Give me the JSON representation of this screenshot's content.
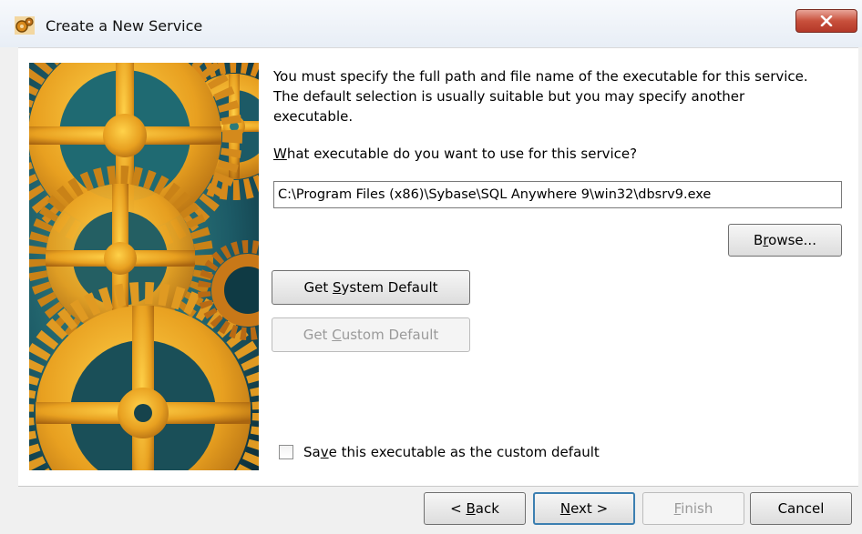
{
  "window": {
    "title": "Create a New Service",
    "icon": "gears-app-icon",
    "close_icon": "close-icon"
  },
  "content": {
    "description": "You must specify the full path and file name of the executable for this service. The default selection is usually suitable but you may specify another executable.",
    "question": {
      "mnemonic": "W",
      "rest": "hat executable do you want to use for this service?"
    },
    "executable_path": "C:\\Program Files (x86)\\Sybase\\SQL Anywhere 9\\win32\\dbsrv9.exe",
    "browse": {
      "pre": "B",
      "mnemonic": "r",
      "post": "owse..."
    },
    "get_system_default": {
      "pre": "Get ",
      "mnemonic": "S",
      "post": "ystem Default"
    },
    "get_custom_default": {
      "pre": "Get ",
      "mnemonic": "C",
      "post": "ustom Default",
      "disabled": true
    },
    "save_checkbox": {
      "pre": "Sa",
      "mnemonic": "v",
      "post": "e this executable as the custom default",
      "checked": false
    }
  },
  "footer": {
    "back": {
      "pre": "< ",
      "mnemonic": "B",
      "post": "ack"
    },
    "next": {
      "pre": "",
      "mnemonic": "N",
      "post": "ext >"
    },
    "finish": {
      "pre": "",
      "mnemonic": "F",
      "post": "inish",
      "disabled": true
    },
    "cancel": {
      "label": "Cancel"
    }
  },
  "colors": {
    "gear_orange": "#e8a020",
    "banner_teal": "#1f6a72",
    "close_red": "#c8503c",
    "default_button_border": "#3c7fb1"
  }
}
